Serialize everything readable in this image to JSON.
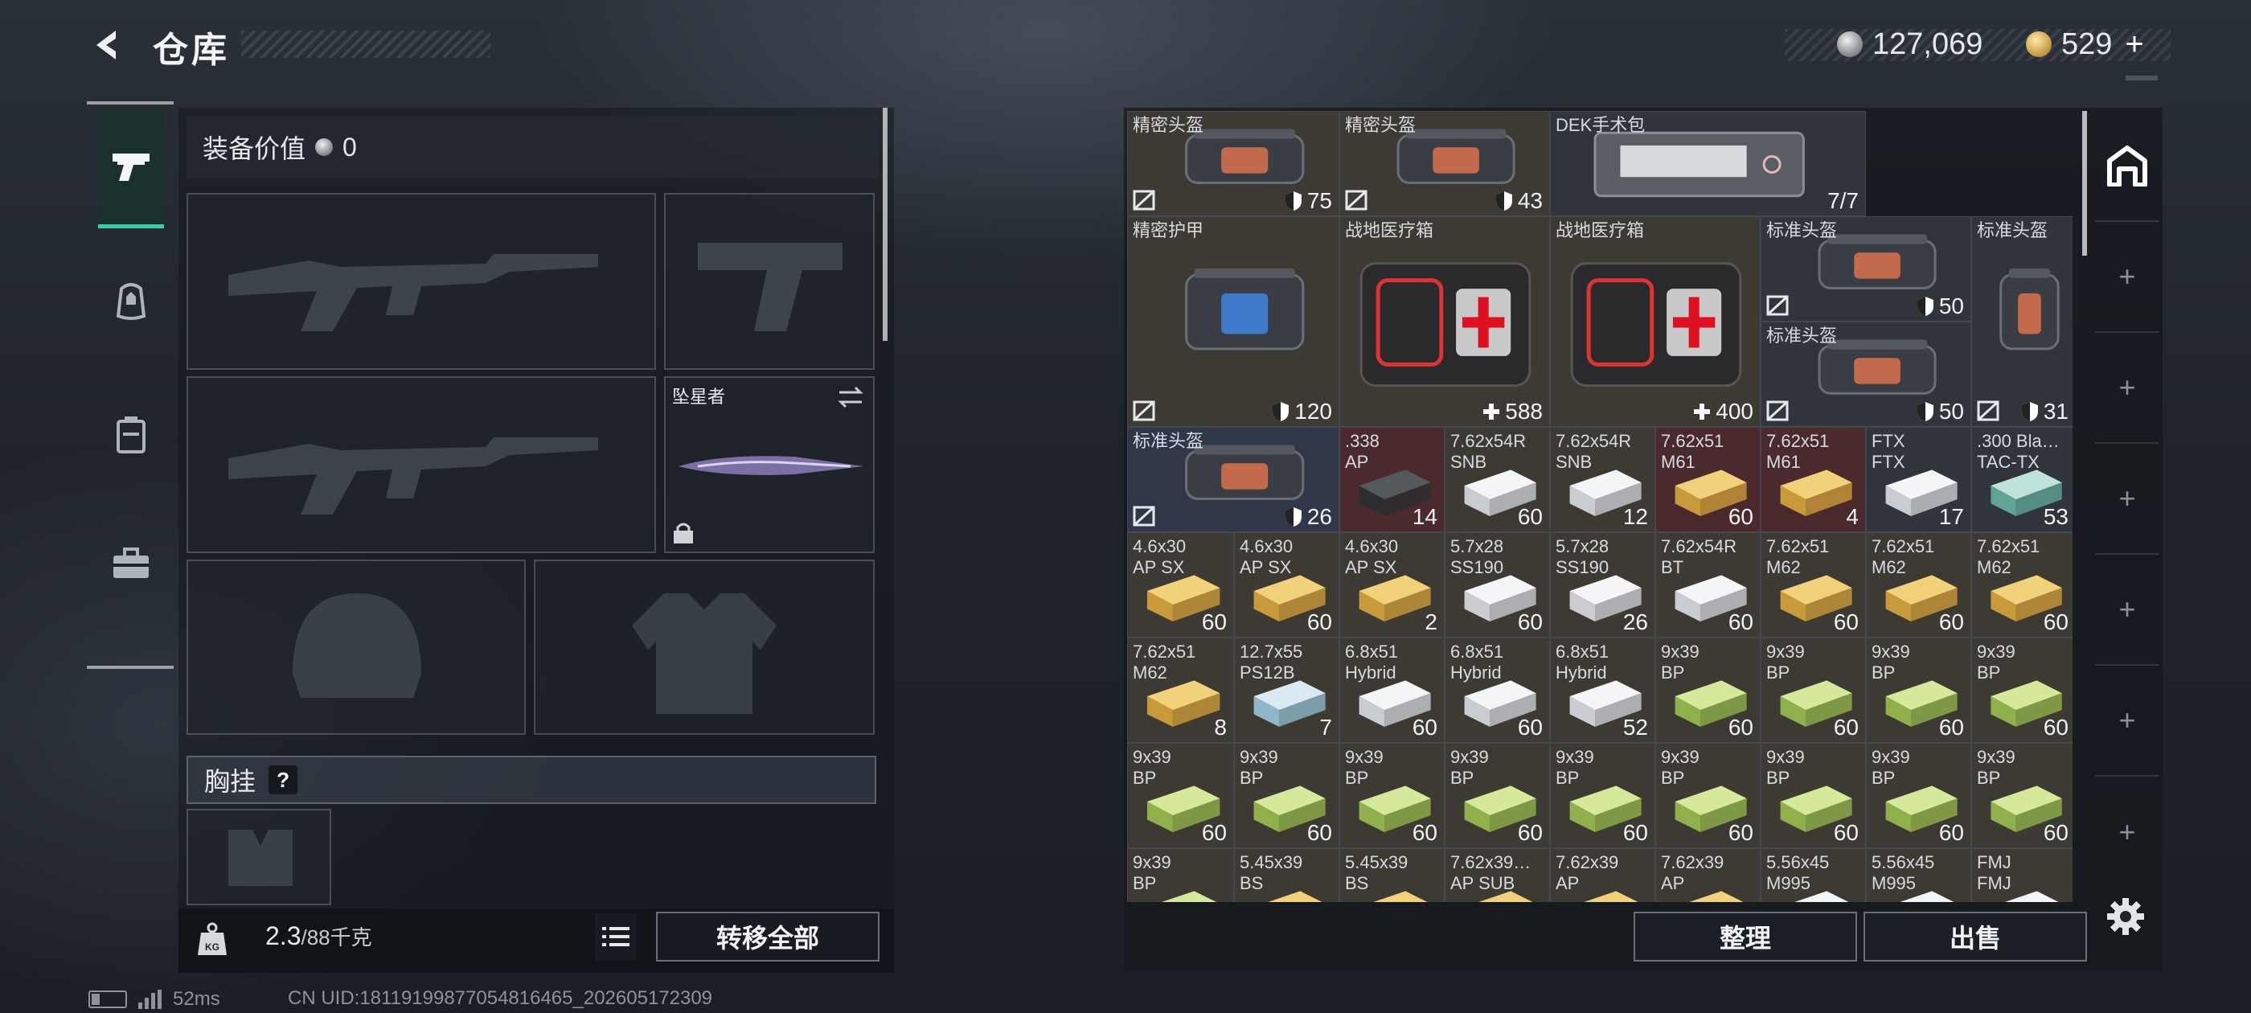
{
  "header": {
    "title": "仓库",
    "silver_amount": "127,069",
    "gold_amount": "529",
    "gold_plus": "+"
  },
  "equipment": {
    "value_label": "装备价值",
    "value": "0",
    "knife_name": "坠星者",
    "rig_label": "胸挂",
    "rig_help": "?"
  },
  "footer_left": {
    "weight_value": "2.3",
    "weight_max": "/88千克",
    "transfer_label": "转移全部"
  },
  "status_bar": {
    "ping": "52ms",
    "uid": "CN UID:181191998770548164​65_202605172309"
  },
  "stash": {
    "sort_label": "整理",
    "sell_label": "出售",
    "items": [
      {
        "name": "精密头盔",
        "count": "75",
        "icon": "shield"
      },
      {
        "name": "精密头盔",
        "count": "43",
        "icon": "shield"
      },
      {
        "name": "DEK手术包",
        "count": "7/7",
        "icon": ""
      },
      {
        "name": "精密护甲",
        "count": "120",
        "icon": "shield"
      },
      {
        "name": "战地医疗箱",
        "count": "588",
        "icon": "cross"
      },
      {
        "name": "战地医疗箱",
        "count": "400",
        "icon": "cross"
      },
      {
        "name": "标准头盔",
        "count": "50",
        "icon": "shield"
      },
      {
        "name": "标准头盔",
        "count": "31",
        "icon": "shield"
      },
      {
        "name": "标准头盔",
        "count": "50",
        "icon": "shield"
      },
      {
        "name": "标准头盔",
        "count": "26",
        "icon": "shield"
      },
      {
        "name": ".338\nAP",
        "count": "14"
      },
      {
        "name": "7.62x54R\nSNB",
        "count": "60"
      },
      {
        "name": "7.62x54R\nSNB",
        "count": "12"
      },
      {
        "name": "7.62x51\nM61",
        "count": "60"
      },
      {
        "name": "7.62x51\nM61",
        "count": "4"
      },
      {
        "name": "FTX\nFTX",
        "count": "17"
      },
      {
        "name": ".300 Bla…\nTAC-TX",
        "count": "53"
      },
      {
        "name": "4.6x30\nAP SX",
        "count": "60"
      },
      {
        "name": "4.6x30\nAP SX",
        "count": "60"
      },
      {
        "name": "4.6x30\nAP SX",
        "count": "2"
      },
      {
        "name": "5.7x28\nSS190",
        "count": "60"
      },
      {
        "name": "5.7x28\nSS190",
        "count": "26"
      },
      {
        "name": "7.62x54R\nBT",
        "count": "60"
      },
      {
        "name": "7.62x51\nM62",
        "count": "60"
      },
      {
        "name": "7.62x51\nM62",
        "count": "60"
      },
      {
        "name": "7.62x51\nM62",
        "count": "60"
      },
      {
        "name": "7.62x51\nM62",
        "count": "8"
      },
      {
        "name": "12.7x55\nPS12B",
        "count": "7"
      },
      {
        "name": "6.8x51\nHybrid",
        "count": "60"
      },
      {
        "name": "6.8x51\nHybrid",
        "count": "60"
      },
      {
        "name": "6.8x51\nHybrid",
        "count": "52"
      },
      {
        "name": "9x39\nBP",
        "count": "60"
      },
      {
        "name": "9x39\nBP",
        "count": "60"
      },
      {
        "name": "9x39\nBP",
        "count": "60"
      },
      {
        "name": "9x39\nBP",
        "count": "60"
      },
      {
        "name": "9x39\nBP",
        "count": "60"
      },
      {
        "name": "9x39\nBP",
        "count": "60"
      },
      {
        "name": "9x39\nBP",
        "count": "60"
      },
      {
        "name": "9x39\nBP",
        "count": "60"
      },
      {
        "name": "9x39\nBP",
        "count": "60"
      },
      {
        "name": "9x39\nBP",
        "count": "60"
      },
      {
        "name": "9x39\nBP",
        "count": "60"
      },
      {
        "name": "9x39\nBP",
        "count": "60"
      },
      {
        "name": "9x39\nBP",
        "count": "60"
      },
      {
        "name": "9x39\nBP",
        "count": ""
      },
      {
        "name": "5.45x39\nBS",
        "count": ""
      },
      {
        "name": "5.45x39\nBS",
        "count": ""
      },
      {
        "name": "7.62x39…\nAP SUB",
        "count": ""
      },
      {
        "name": "7.62x39\nAP",
        "count": ""
      },
      {
        "name": "7.62x39\nAP",
        "count": ""
      },
      {
        "name": "5.56x45\nM995",
        "count": ""
      },
      {
        "name": "5.56x45\nM995",
        "count": ""
      },
      {
        "name": "FMJ\nFMJ",
        "count": ""
      }
    ]
  }
}
